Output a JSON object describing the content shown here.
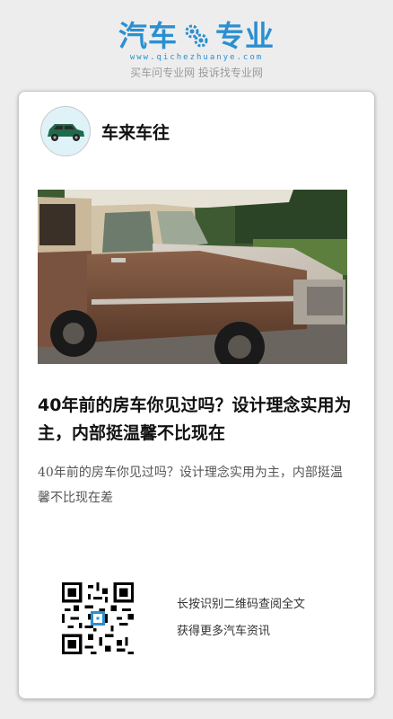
{
  "brand": {
    "name_left": "汽车",
    "name_right": "专业",
    "url": "www.qichezhuanye.com",
    "slogan": "买车问专业网 投诉找专业网",
    "color": "#2b8fd0"
  },
  "article": {
    "author": "车来车往",
    "title": "40年前的房车你见过吗？设计理念实用为主，内部挺温馨不比现在",
    "summary": "40年前的房车你见过吗？设计理念实用为主，内部挺温馨不比现在差"
  },
  "qr": {
    "line1": "长按识别二维码查阅全文",
    "line2": "获得更多汽车资讯"
  }
}
